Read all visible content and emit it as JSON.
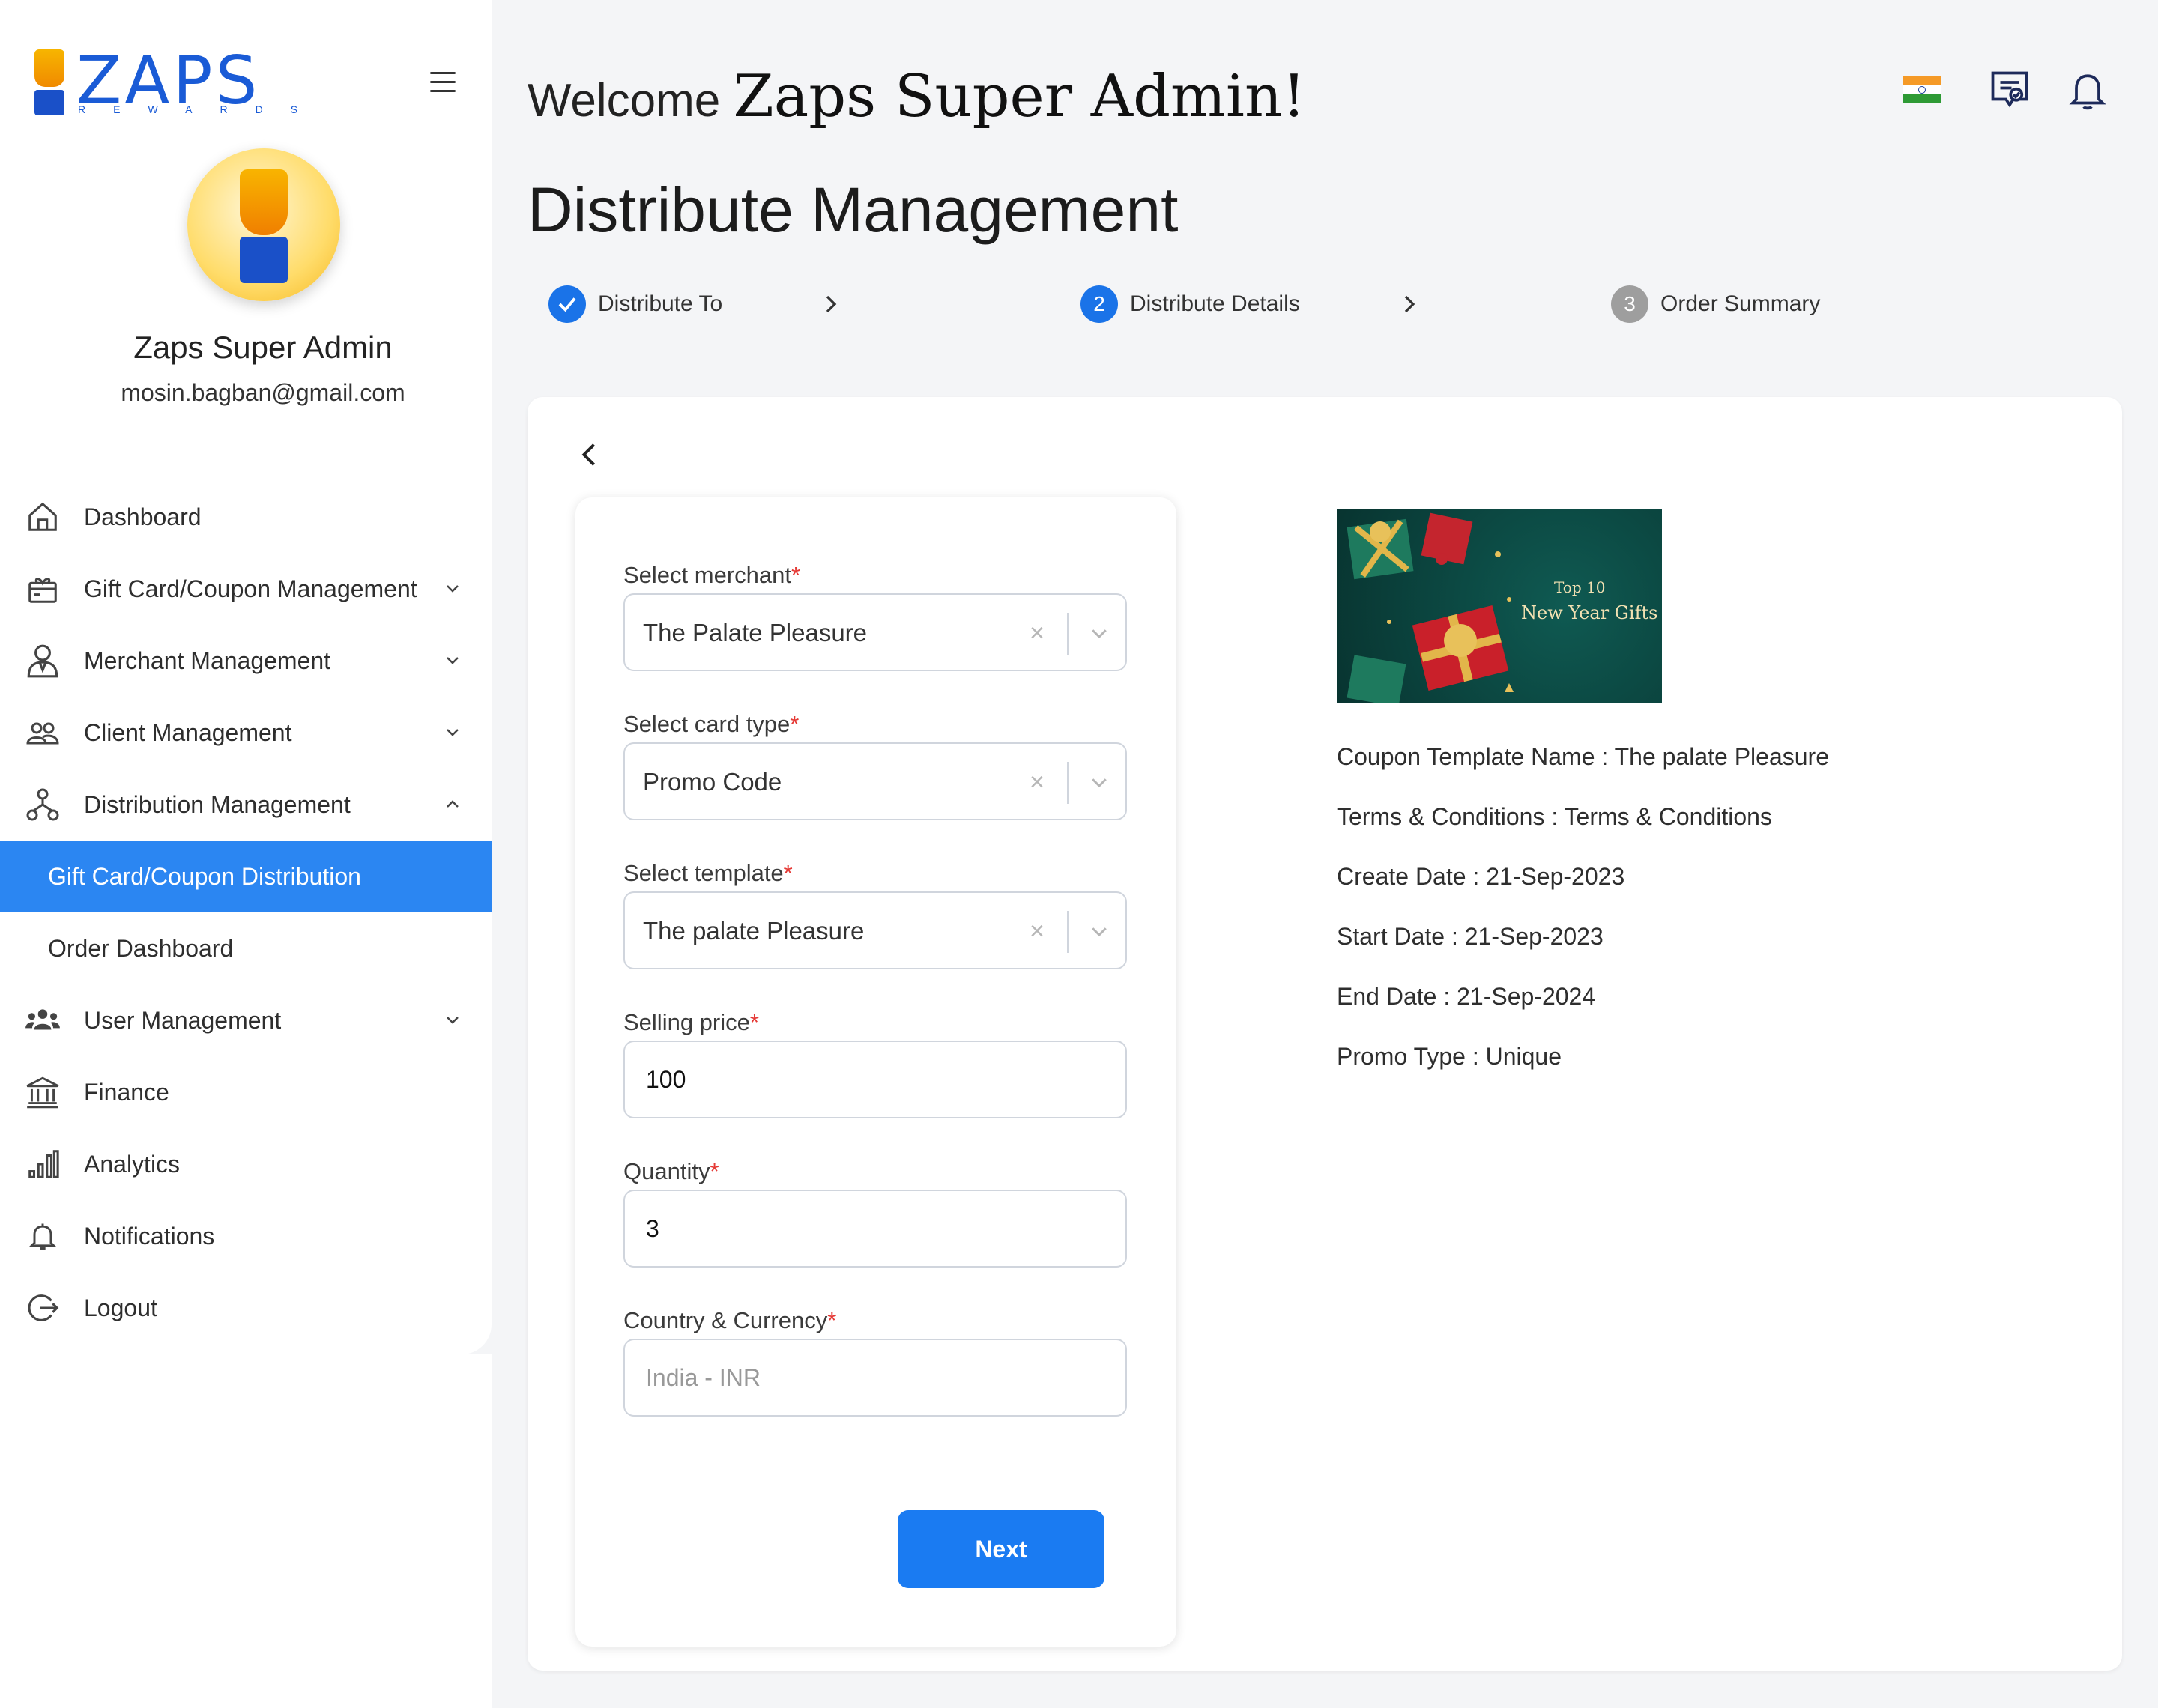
{
  "brand": {
    "logo_text": "ZAPS",
    "logo_sub": "REWARDS"
  },
  "user": {
    "name": "Zaps Super Admin",
    "email": "mosin.bagban@gmail.com"
  },
  "nav": {
    "dashboard": "Dashboard",
    "giftcard": "Gift Card/Coupon Management",
    "merchant": "Merchant Management",
    "client": "Client Management",
    "distribution": "Distribution Management",
    "distribution_sub": [
      "Gift Card/Coupon Distribution",
      "Order Dashboard"
    ],
    "user": "User Management",
    "finance": "Finance",
    "analytics": "Analytics",
    "notifications": "Notifications",
    "logout": "Logout"
  },
  "header": {
    "welcome": "Welcome",
    "welcome_name": "Zaps Super Admin!",
    "page_title": "Distribute Management"
  },
  "stepper": {
    "step1": "Distribute To",
    "step2_num": "2",
    "step2": "Distribute Details",
    "step3_num": "3",
    "step3": "Order Summary"
  },
  "form": {
    "merchant_label": "Select merchant",
    "merchant_value": "The Palate Pleasure",
    "card_type_label": "Select card type",
    "card_type_value": "Promo Code",
    "template_label": "Select template",
    "template_value": "The palate Pleasure",
    "price_label": "Selling price",
    "price_value": "100",
    "quantity_label": "Quantity",
    "quantity_value": "3",
    "country_label": "Country & Currency",
    "country_value": "India - INR",
    "required_mark": "*",
    "clear_glyph": "×",
    "next": "Next"
  },
  "preview": {
    "image_title_1": "Top 10",
    "image_title_2": "New Year Gifts",
    "lines": [
      "Coupon Template Name : The palate Pleasure",
      "Terms & Conditions : Terms & Conditions",
      "Create Date : 21-Sep-2023",
      "Start Date : 21-Sep-2023",
      "End Date : 21-Sep-2024",
      "Promo Type : Unique"
    ]
  },
  "colors": {
    "primary": "#1a7bf2",
    "active_nav": "#2b86f2",
    "required": "#e53935",
    "step_done": "#1a73e8",
    "step_pending": "#9e9e9e"
  },
  "icons": [
    "menu-icon",
    "india-flag-icon",
    "chat-check-icon",
    "bell-icon",
    "home-icon",
    "gift-icon",
    "merchant-icon",
    "clients-icon",
    "distribution-icon",
    "users-icon",
    "bank-icon",
    "bar-chart-icon",
    "bell-icon",
    "logout-icon",
    "chevron-down-icon",
    "chevron-up-icon",
    "chevron-right-icon",
    "check-icon",
    "chevron-left-icon"
  ]
}
